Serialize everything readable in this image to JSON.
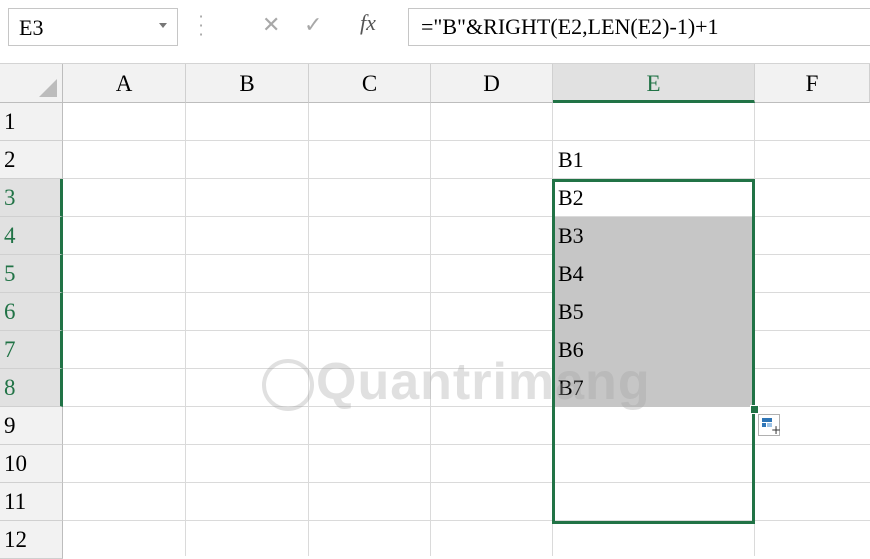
{
  "formula_bar": {
    "name_box": "E3",
    "cancel_icon": "close-icon",
    "enter_icon": "check-icon",
    "fx_label": "fx",
    "formula": "=\"B\"&RIGHT(E2,LEN(E2)-1)+1"
  },
  "columns": [
    "A",
    "B",
    "C",
    "D",
    "E",
    "F"
  ],
  "rows": [
    "1",
    "2",
    "3",
    "4",
    "5",
    "6",
    "7",
    "8",
    "9",
    "10",
    "11",
    "12"
  ],
  "active_column": "E",
  "selection": "E3:E11",
  "cells": {
    "E2": "B1",
    "E3": "B2",
    "E4": "B3",
    "E5": "B4",
    "E6": "B5",
    "E7": "B6",
    "E8": "B7"
  },
  "colors": {
    "accent": "#217346",
    "shaded_cell": "#c6c6c6",
    "header_bg": "#f2f2f2"
  },
  "watermark": "Quantrimang"
}
